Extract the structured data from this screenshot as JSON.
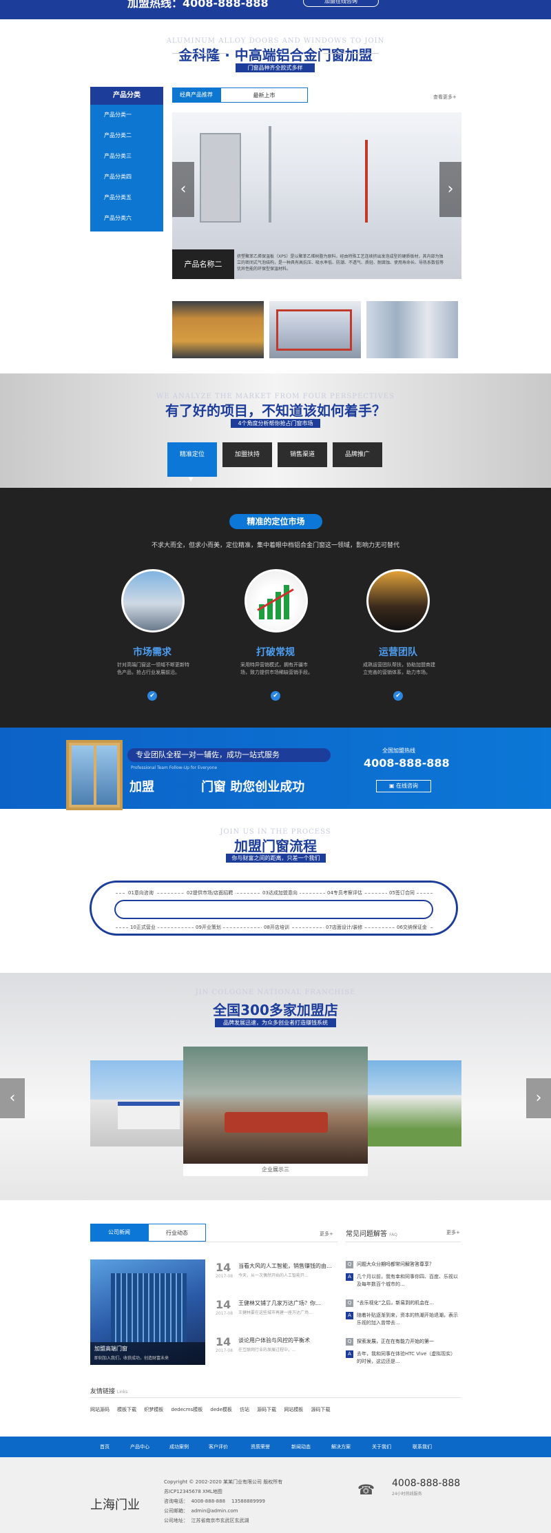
{
  "topbar": {
    "hotline": "加盟热线：4008-888-888",
    "consult": "加盟在线咨询"
  },
  "join": {
    "en": "ALUMINUM ALLOY DOORS AND WINDOWS TO JOIN",
    "title": "金科隆 · 中高端铝合金门窗加盟",
    "subtitle": "门窗品种齐全款式多样"
  },
  "category": {
    "heading": "产品分类",
    "items": [
      "产品分类一",
      "产品分类二",
      "产品分类三",
      "产品分类四",
      "产品分类五",
      "产品分类六"
    ]
  },
  "product_tabs": {
    "tab1": "经典产品推荐",
    "tab2": "最新上市",
    "more": "查看更多+"
  },
  "slider": {
    "caption": "产品名称二",
    "desc": "挤塑聚苯乙烯保温板（XPS）是以聚苯乙烯树脂为原料，经由特殊工艺连续挤出发泡成型的硬质板材，其内部为独立的密闭式气泡结构，是一种具有高抗压、吸水率低、防潮、不透气、质轻、耐腐蚀、使用寿命长、导热系数低等优异性能的环保型保温材料。",
    "prev": "‹",
    "next": "›"
  },
  "analysis": {
    "en": "WE ANALYZE THE MARKET FROM FOUR PERSPECTIVES",
    "title": "有了好的项目，不知道该如何着手？",
    "subtitle": "4个角度分析帮你抢占门窗市场",
    "tabs": [
      "精准定位",
      "加盟扶持",
      "销售渠道",
      "品牌推广"
    ]
  },
  "positioning": {
    "title": "精准的定位市场",
    "desc": "不求大而全，但求小而美，定位精准，集中着眼中档铝合金门窗这一领域，影响力无可替代",
    "cards": [
      {
        "title": "市场需求",
        "text": "针对高端门窗这一领域不断更新特色产品，抢占行业发展前沿。"
      },
      {
        "title": "打破常规",
        "text": "采用特异营销模式，拥有开疆市场，致力提供市场稀缺营销手段。"
      },
      {
        "title": "运营团队",
        "text": "成熟运营团队帮扶，协助加盟商建立完善的营销体系，助力市场。"
      }
    ],
    "check": "✔"
  },
  "banner": {
    "slogan": "专业团队全程一对一辅佐，成功一站式服务",
    "small": "Professional Team Follow-Up for Everyone",
    "big1": "加盟",
    "big2": "门窗 助您创业成功",
    "hotline_label": "全国加盟热线",
    "hotline": "4008-888-888",
    "consult": "在线咨询"
  },
  "process": {
    "en": "JOIN US IN THE PROCESS",
    "title": "加盟门窗流程",
    "subtitle": "你与财富之间的距离，只差一个我们",
    "top_steps": [
      "01意向咨询",
      "02提供市场/店面招聘",
      "03达成加盟意向",
      "04专员考察评估",
      "05签订合同"
    ],
    "bottom_steps": [
      "10正式营业",
      "09开业策划",
      "08开店培训",
      "07店面设计/装修",
      "06交纳保证金"
    ]
  },
  "stores": {
    "en": "JIN COLOGNE NATIONAL FRANCHISE",
    "title": "全国300多家加盟店",
    "subtitle": "品牌发展迅速，为众多创业者打造赚钱系统",
    "caption": "企业展示三",
    "prev": "‹",
    "next": "›"
  },
  "news": {
    "tab1": "公司新闻",
    "tab2": "行业动态",
    "more": "更多+",
    "feature_title": "加盟高端门窗",
    "feature_caption": "即刻加入我们，收获成功，创造财富未来",
    "items": [
      {
        "day": "14",
        "ym": "2017-08",
        "title": "当看大风的人工智能，销售赚钱的由...",
        "sub": "今天，从一次偶然开始的人工智能开..."
      },
      {
        "day": "14",
        "ym": "2017-08",
        "title": "王健林又铺了几家万达广场？你...",
        "sub": "王健林要在这些城市再建一座万达广场..."
      },
      {
        "day": "14",
        "ym": "2017-08",
        "title": "谈论用户体验与风控的平衡术",
        "sub": "在互联网行业的发展过程中，..."
      }
    ]
  },
  "faq": {
    "title": "常见问题解答",
    "tag": "FAQ",
    "more": "更多+",
    "items": [
      {
        "q": "问题大众分期吗都常问解答答尊享？",
        "a": "几个月以前，我有幸和同事你四、百度、乐视以及每年数百个城市的..."
      },
      {
        "q": "“去乐视化”之后，新易到的机会在...",
        "a": "随着补贴逐渐到来，资本的热潮开始退潮，表示乐视的加入曾带去..."
      },
      {
        "q": "探索发展，正在在有能力开始的第一",
        "a": "去年，我和同事在体验HTC Vive（虚拟现实）的时候，这边还是..."
      }
    ]
  },
  "links": {
    "title": "友情链接",
    "tag": "Links",
    "items": [
      "网站源码",
      "模板下载",
      "织梦模板",
      "dedecms模板",
      "dede模板",
      "仿站",
      "源码下载",
      "网站模板",
      "源码下载"
    ]
  },
  "footnav": [
    "首页",
    "产品中心",
    "成功案例",
    "客户评价",
    "资质荣誉",
    "新闻动态",
    "解决方案",
    "关于我们",
    "联系我们"
  ],
  "footer": {
    "logo": "上海门业",
    "copyright": "Copyright © 2002-2020 某某门业有限公司 版权所有",
    "icp": "苏ICP12345678 XML地图",
    "phone": "咨询电话：  4008-888-888    13588889999",
    "email": "公司邮箱：  admin@admin.com",
    "address": "公司地址：  江苏省南京市玄武区玄武湖",
    "hotline": "4008-888-888",
    "hotline_sub": "24小时热线服务"
  },
  "colors": {
    "brand": "#1d3d9b",
    "accent": "#0c77d6",
    "dark": "#222222"
  }
}
